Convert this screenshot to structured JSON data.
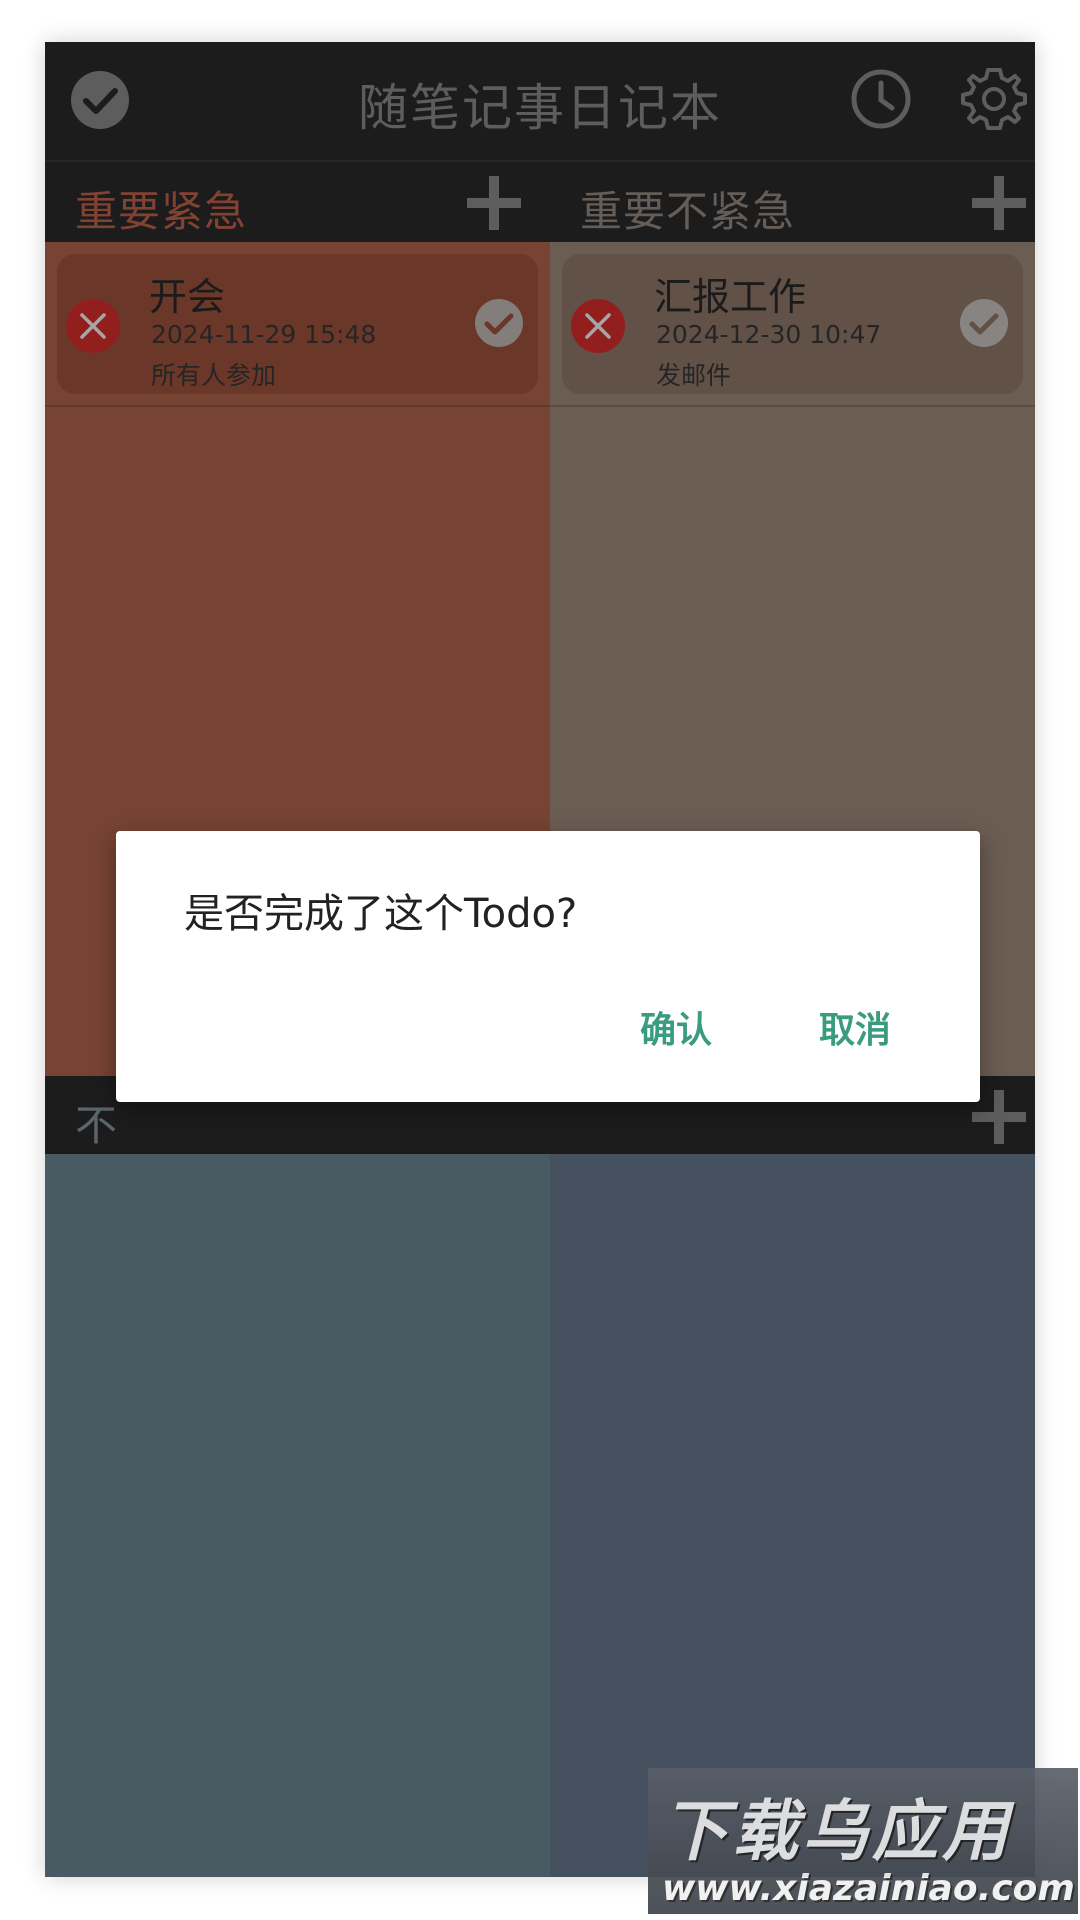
{
  "app": {
    "title": "随笔记事日记本"
  },
  "quadrants": [
    {
      "title": "重要紧急",
      "title_color": "#c8664c",
      "panel_color": "#b7684f",
      "todos": [
        {
          "title": "开会",
          "datetime": "2024-11-29 15:48",
          "description": "所有人参加"
        }
      ]
    },
    {
      "title": "重要不紧急",
      "title_color": "#9b8f86",
      "panel_color": "#a78f80",
      "todos": [
        {
          "title": "汇报工作",
          "datetime": "2024-12-30 10:47",
          "description": "发邮件"
        }
      ]
    },
    {
      "title": "不",
      "title_color": "#8a9ea2",
      "panel_color": "#6f8d98",
      "todos": []
    },
    {
      "title": "",
      "title_color": "#8a9ea2",
      "panel_color": "#6b7d93",
      "todos": []
    }
  ],
  "dialog": {
    "message": "是否完成了这个Todo?",
    "confirm_label": "确认",
    "cancel_label": "取消",
    "accent_color": "#3a9c7f"
  },
  "watermark": {
    "text": "下载乌应用",
    "url": "www.xiazainiao.com"
  },
  "icons": {
    "app_check": "check-circle-icon",
    "history": "clock-icon",
    "settings": "gear-icon",
    "add": "plus-icon",
    "delete": "close-circle-icon",
    "done": "check-circle-icon"
  }
}
